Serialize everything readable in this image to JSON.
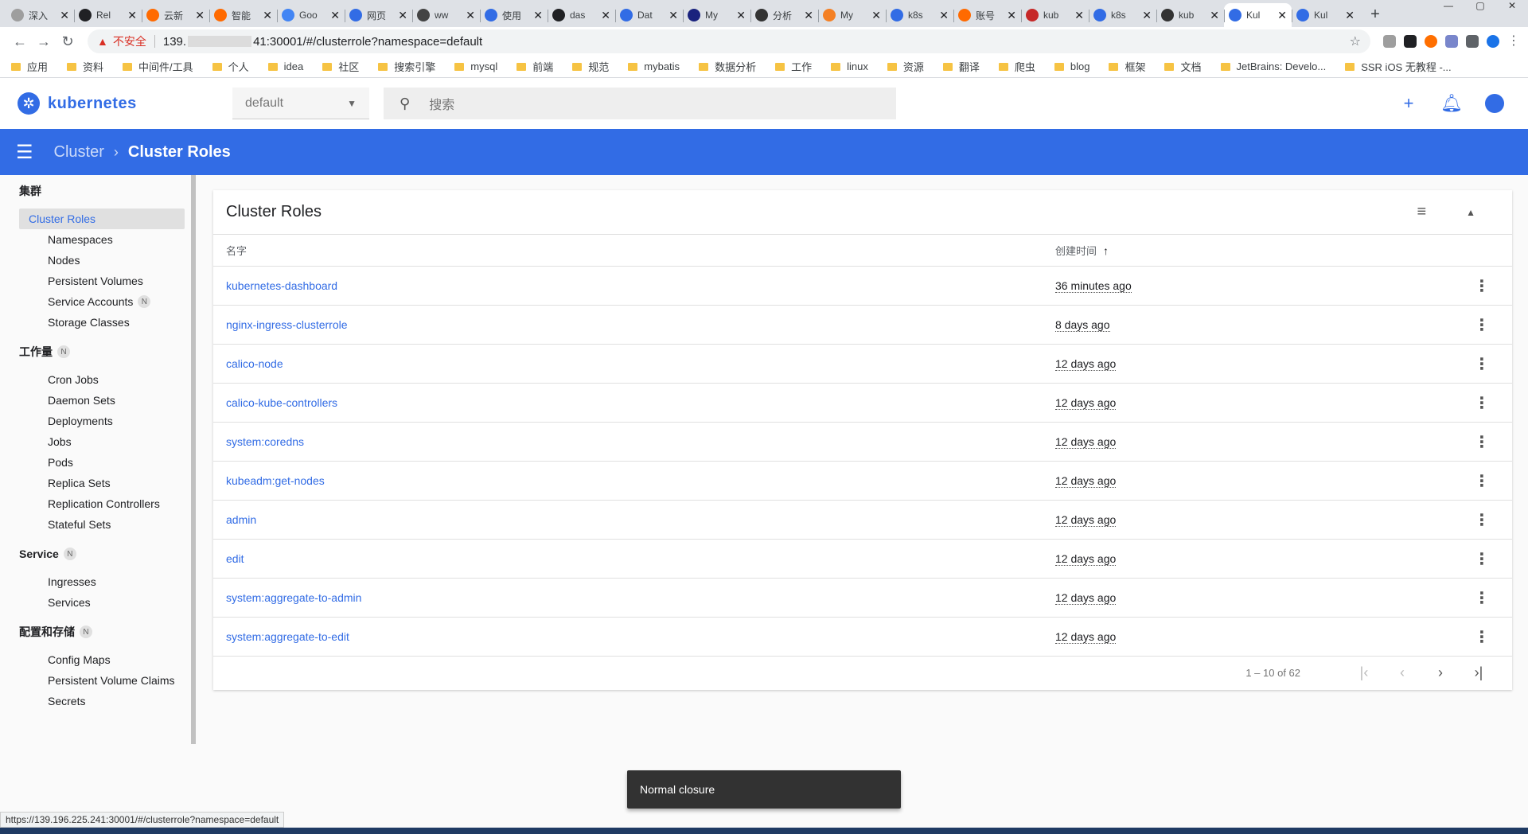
{
  "browser": {
    "tabs": [
      {
        "title": "深入",
        "color": "#9e9e9e"
      },
      {
        "title": "Rel",
        "color": "#202124"
      },
      {
        "title": "云新",
        "color": "#ff6a00"
      },
      {
        "title": "智能",
        "color": "#ff6a00"
      },
      {
        "title": "Goo",
        "color": "#4285f4"
      },
      {
        "title": "网页",
        "color": "#326ce5"
      },
      {
        "title": "ww",
        "color": "#444"
      },
      {
        "title": "使用",
        "color": "#326ce5"
      },
      {
        "title": "das",
        "color": "#202124"
      },
      {
        "title": "Dat",
        "color": "#326ce5"
      },
      {
        "title": "My",
        "color": "#1a237e"
      },
      {
        "title": "分析",
        "color": "#333"
      },
      {
        "title": "My",
        "color": "#f48024"
      },
      {
        "title": "k8s",
        "color": "#326ce5"
      },
      {
        "title": "账号",
        "color": "#ff6a00"
      },
      {
        "title": "kub",
        "color": "#c62828"
      },
      {
        "title": "k8s",
        "color": "#326ce5"
      },
      {
        "title": "kub",
        "color": "#333"
      },
      {
        "title": "Kul",
        "color": "#326ce5",
        "active": true
      },
      {
        "title": "Kul",
        "color": "#326ce5"
      }
    ],
    "not_secure": "不安全",
    "url_prefix": "139.",
    "url_suffix": "41:30001/#/clusterrole?namespace=default",
    "bookmarks": [
      "应用",
      "资料",
      "中间件/工具",
      "个人",
      "idea",
      "社区",
      "搜索引擎",
      "mysql",
      "前端",
      "规范",
      "mybatis",
      "数据分析",
      "工作",
      "linux",
      "资源",
      "翻译",
      "爬虫",
      "blog",
      "框架",
      "文档",
      "JetBrains: Develo...",
      "SSR iOS 无教程 -..."
    ],
    "status_url": "https://139.196.225.241:30001/#/clusterrole?namespace=default"
  },
  "header": {
    "logo_text": "kubernetes",
    "namespace": "default",
    "search_placeholder": "搜索"
  },
  "toolbar": {
    "crumb_parent": "Cluster",
    "crumb_current": "Cluster Roles"
  },
  "sidebar": {
    "sections": [
      {
        "heading": "集群",
        "badge": "",
        "items": [
          {
            "label": "Cluster Roles",
            "selected": true
          },
          {
            "label": "Namespaces"
          },
          {
            "label": "Nodes"
          },
          {
            "label": "Persistent Volumes"
          },
          {
            "label": "Service Accounts",
            "badge": "N"
          },
          {
            "label": "Storage Classes"
          }
        ]
      },
      {
        "heading": "工作量",
        "badge": "N",
        "items": [
          {
            "label": "Cron Jobs"
          },
          {
            "label": "Daemon Sets"
          },
          {
            "label": "Deployments"
          },
          {
            "label": "Jobs"
          },
          {
            "label": "Pods"
          },
          {
            "label": "Replica Sets"
          },
          {
            "label": "Replication Controllers"
          },
          {
            "label": "Stateful Sets"
          }
        ]
      },
      {
        "heading": "Service",
        "badge": "N",
        "items": [
          {
            "label": "Ingresses"
          },
          {
            "label": "Services"
          }
        ]
      },
      {
        "heading": "配置和存储",
        "badge": "N",
        "items": [
          {
            "label": "Config Maps"
          },
          {
            "label": "Persistent Volume Claims"
          },
          {
            "label": "Secrets"
          }
        ]
      }
    ]
  },
  "card": {
    "title": "Cluster Roles",
    "col_name": "名字",
    "col_created": "创建时间",
    "rows": [
      {
        "name": "kubernetes-dashboard",
        "age": "36 minutes ago"
      },
      {
        "name": "nginx-ingress-clusterrole",
        "age": "8 days ago"
      },
      {
        "name": "calico-node",
        "age": "12 days ago"
      },
      {
        "name": "calico-kube-controllers",
        "age": "12 days ago"
      },
      {
        "name": "system:coredns",
        "age": "12 days ago"
      },
      {
        "name": "kubeadm:get-nodes",
        "age": "12 days ago"
      },
      {
        "name": "admin",
        "age": "12 days ago"
      },
      {
        "name": "edit",
        "age": "12 days ago"
      },
      {
        "name": "system:aggregate-to-admin",
        "age": "12 days ago"
      },
      {
        "name": "system:aggregate-to-edit",
        "age": "12 days ago"
      }
    ],
    "pager_range": "1 – 10 of 62"
  },
  "snackbar": "Normal closure",
  "colors": {
    "accent": "#326ce5"
  }
}
